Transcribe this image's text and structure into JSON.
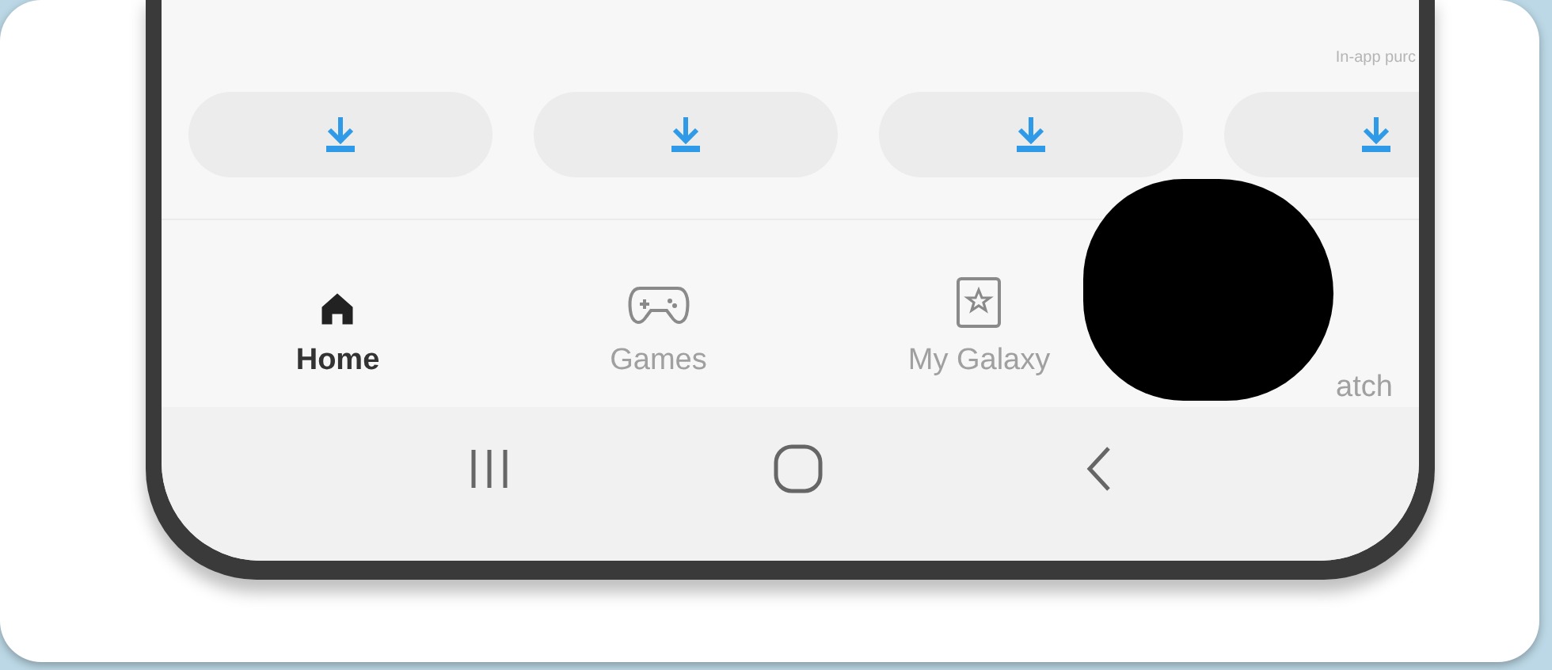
{
  "app_list": {
    "purchase_note": "In-app purc",
    "download_buttons": [
      {
        "kind": "download"
      },
      {
        "kind": "download"
      },
      {
        "kind": "download"
      },
      {
        "kind": "download"
      }
    ]
  },
  "bottom_tabs": [
    {
      "label": "Home",
      "kind": "home",
      "selected": true
    },
    {
      "label": "Games",
      "kind": "gamepad",
      "selected": false
    },
    {
      "label": "My Galaxy",
      "kind": "star-box",
      "selected": false
    },
    {
      "label": "atch",
      "kind": "redacted",
      "selected": false
    }
  ],
  "nav_bar": [
    {
      "kind": "recents"
    },
    {
      "kind": "home"
    },
    {
      "kind": "back"
    }
  ]
}
